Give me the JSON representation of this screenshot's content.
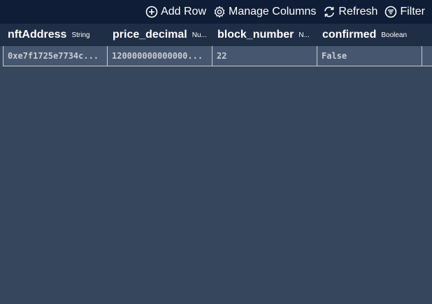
{
  "toolbar": {
    "add_row": "Add Row",
    "manage_columns": "Manage Columns",
    "refresh": "Refresh",
    "filter": "Filter"
  },
  "columns": [
    {
      "name": "nftAddress",
      "type": "String"
    },
    {
      "name": "price_decimal",
      "type": "Nu..."
    },
    {
      "name": "block_number",
      "type": "N..."
    },
    {
      "name": "confirmed",
      "type": "Boolean"
    }
  ],
  "rows": [
    [
      "0xe7f1725e7734c...",
      "120000000000000...",
      "22",
      "False"
    ]
  ],
  "colors": {
    "toolbar_bg": "#0f1d36",
    "header_bg": "#1f2d45",
    "body_bg": "#36465d",
    "row_bg": "#46566e"
  }
}
